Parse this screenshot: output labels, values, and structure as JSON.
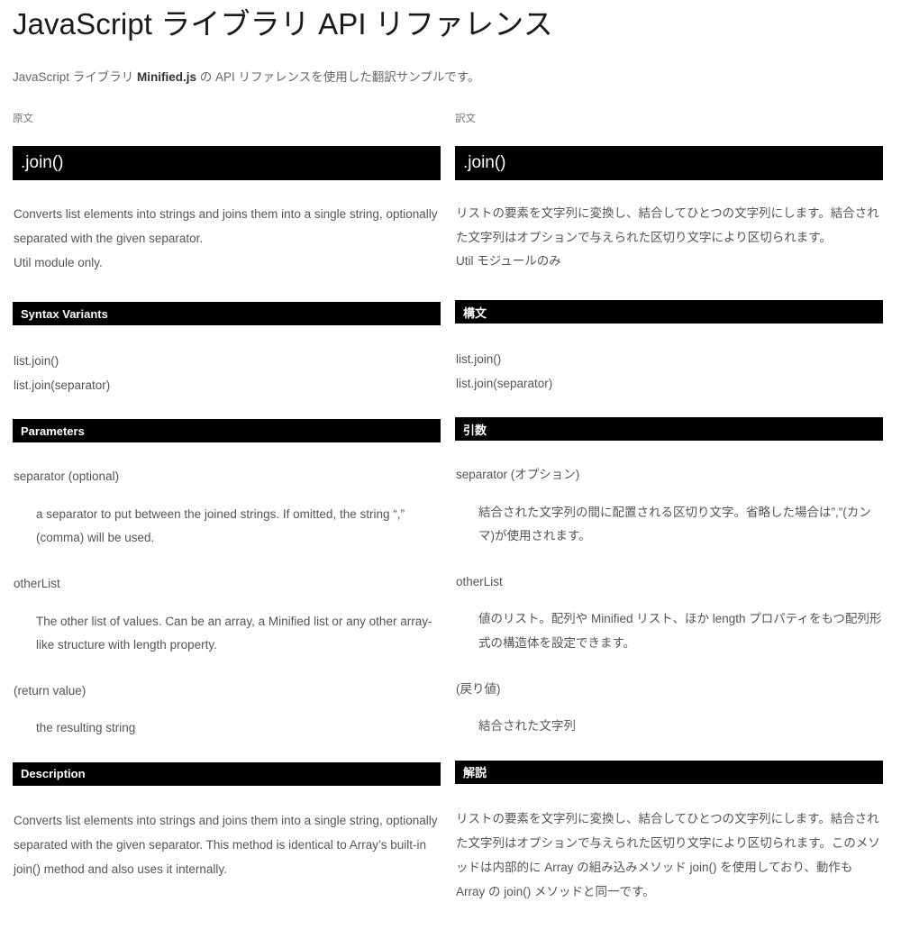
{
  "header": {
    "title": "JavaScript ライブラリ API リファレンス",
    "subtitle_before": "JavaScript ライブラリ ",
    "subtitle_strong": "Minified.js",
    "subtitle_after": " の API リファレンスを使用した翻訳サンプルです。"
  },
  "columns": {
    "source_label": "原文",
    "target_label": "訳文"
  },
  "source": {
    "method_title": ".join()",
    "summary": "Converts list elements into strings and joins them into a single string, optionally separated with the given separator.",
    "summary_note": "Util module only.",
    "syntax_heading": "Syntax Variants",
    "syntax_lines": [
      "list.join()",
      "list.join(separator)"
    ],
    "parameters_heading": "Parameters",
    "parameters": [
      {
        "name": "separator (optional)",
        "description": "a separator to put between the joined strings. If omitted, the string “,” (comma) will be used."
      },
      {
        "name": "otherList",
        "description": "The other list of values. Can be an array, a Minified list or any other array-like structure with length property."
      },
      {
        "name": "(return value)",
        "description": "the resulting string"
      }
    ],
    "description_heading": "Description",
    "description": "Converts list elements into strings and joins them into a single string, optionally separated with the given separator. This method is identical to Array’s built-in join() method and also uses it internally."
  },
  "target": {
    "method_title": ".join()",
    "summary": "リストの要素を文字列に変換し、結合してひとつの文字列にします。結合された文字列はオプションで与えられた区切り文字により区切られます。",
    "summary_note": "Util モジュールのみ",
    "syntax_heading": "構文",
    "syntax_lines": [
      "list.join()",
      "list.join(separator)"
    ],
    "parameters_heading": "引数",
    "parameters": [
      {
        "name": "separator (オプション)",
        "description": "結合された文字列の間に配置される区切り文字。省略した場合は”,”(カンマ)が使用されます。"
      },
      {
        "name": "otherList",
        "description": "値のリスト。配列や Minified リスト、ほか length プロパティをもつ配列形式の構造体を設定できます。"
      },
      {
        "name": "(戻り値)",
        "description": "結合された文字列"
      }
    ],
    "description_heading": "解説",
    "description": "リストの要素を文字列に変換し、結合してひとつの文字列にします。結合された文字列はオプションで与えられた区切り文字により区切られます。このメソッドは内部的に Array の組み込みメソッド join() を使用しており、動作も Array の join() メソッドと同一です。"
  },
  "colors": {
    "bar_background": "#000000",
    "bar_text": "#ffffff",
    "body_text": "#555555",
    "title_text": "#1a1a1a"
  }
}
